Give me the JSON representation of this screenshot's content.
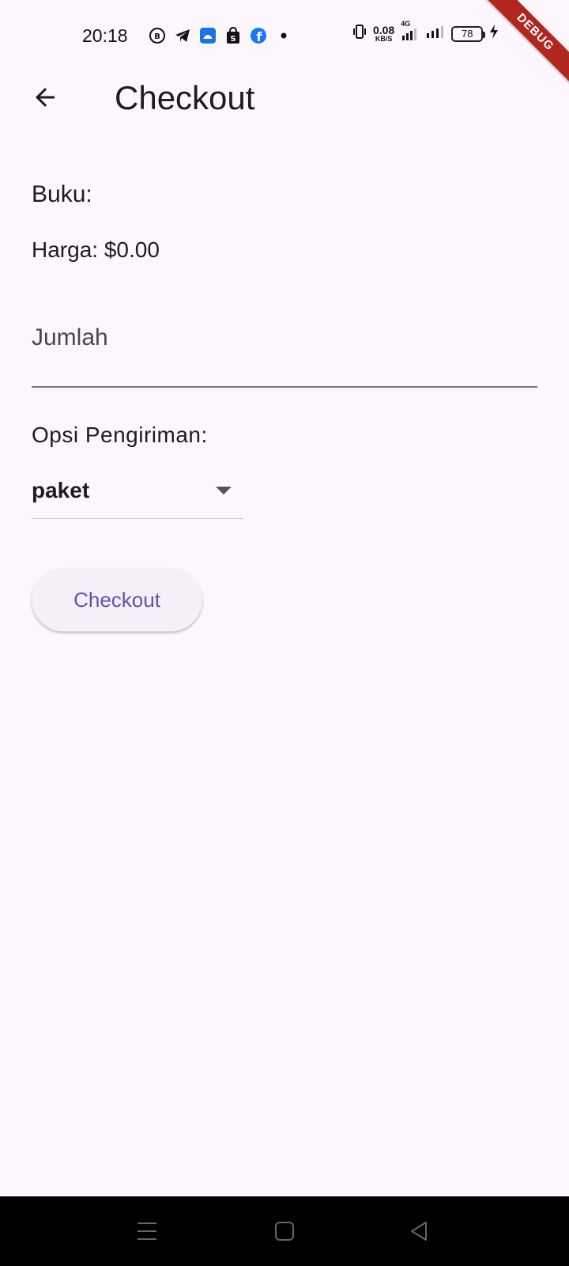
{
  "status_bar": {
    "time": "20:18",
    "net_speed_value": "0.08",
    "net_speed_unit": "KB/S",
    "network_type": "4G",
    "battery": "78"
  },
  "debug_banner": "DEBUG",
  "app_bar": {
    "title": "Checkout"
  },
  "form": {
    "book_label": "Buku:",
    "price_label": "Harga: $0.00",
    "quantity_placeholder": "Jumlah",
    "shipping_label": "Opsi Pengiriman:",
    "shipping_selected": "paket",
    "checkout_button": "Checkout"
  },
  "colors": {
    "background": "#fdf7fd",
    "primary": "#6750a4",
    "debug": "#b3261e"
  }
}
